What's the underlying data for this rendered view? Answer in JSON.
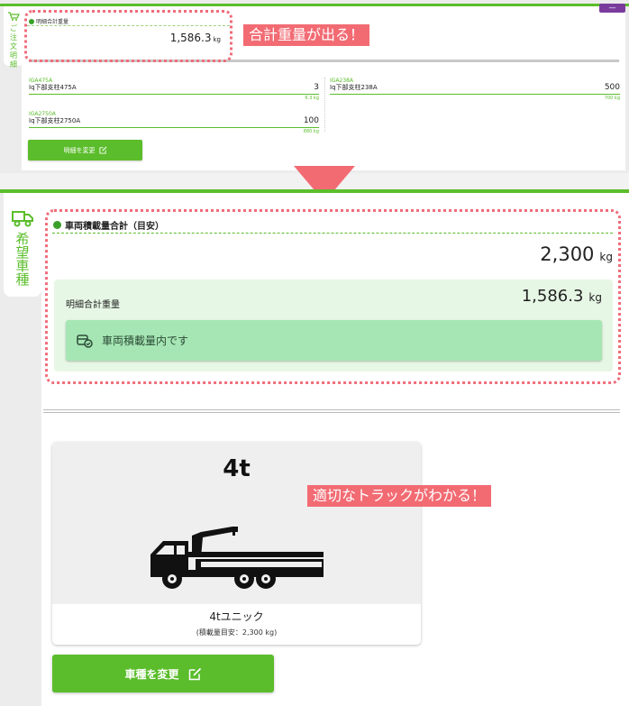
{
  "top_panel": {
    "tab_label": "ご注文明細",
    "menu_badge": "—",
    "total_weight_label": "明細合計重量",
    "total_weight_value": "1,586.3",
    "total_weight_unit": "kg",
    "items": [
      {
        "code": "IGA475A",
        "name": "Iq下部支柱475A",
        "qty": "3",
        "weight": "6.3",
        "unit": "kg"
      },
      {
        "code": "IGA238A",
        "name": "Iq下部支柱238A",
        "qty": "500",
        "weight": "700",
        "unit": "kg"
      },
      {
        "code": "IGA2750A",
        "name": "Iq下部支柱2750A",
        "qty": "100",
        "weight": "880",
        "unit": "kg"
      }
    ],
    "change_button": "明細を変更",
    "callout": "合計重量が出る！"
  },
  "bottom_panel": {
    "tab_label": "希望車種",
    "capacity_label": "車両積載量合計（目安）",
    "capacity_value": "2,300",
    "capacity_unit": "kg",
    "total_label": "明細合計重量",
    "total_value": "1,586.3",
    "total_unit": "kg",
    "status_text": "車両積載量内です",
    "truck": {
      "tonnage": "4t",
      "name": "4tユニック",
      "capacity_note": "(積載量目安：2,300 kg)"
    },
    "change_button": "車種を変更",
    "callout": "適切なトラックがわかる！"
  },
  "colors": {
    "accent_green": "#5bbd2b",
    "callout_pink": "#f26b73",
    "ok_green": "#a6e6b4",
    "badge_purple": "#7a3b9c"
  }
}
